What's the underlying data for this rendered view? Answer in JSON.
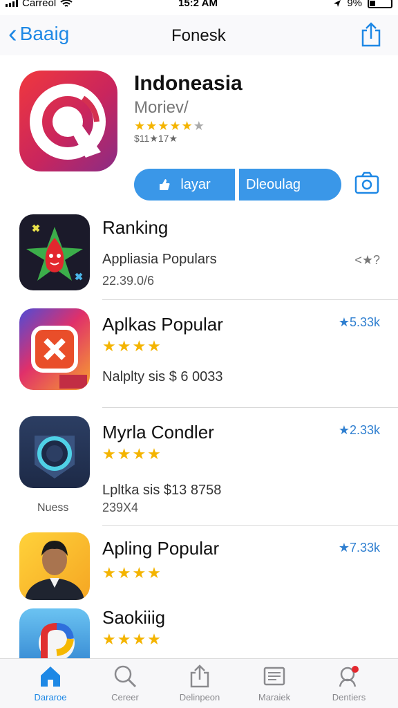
{
  "status": {
    "carrier": "Carreol",
    "time": "15:2 AM",
    "battery": "9%"
  },
  "nav": {
    "back_label": "Baaig",
    "title": "Fonesk"
  },
  "hero": {
    "name": "Indoneasia",
    "subtitle": "Moriev/",
    "stars": 5,
    "meta": "$11★17★",
    "play_label": "layar",
    "download_label": "Dleoulag"
  },
  "list": [
    {
      "title": "Ranking",
      "detail": "Appliasia Populars",
      "meta": "22.39.0/6",
      "rating": "<★?"
    },
    {
      "title": "Aplkas Popular",
      "detail": "Nalplty sis $ 6 0033",
      "rating": "★5.33k",
      "stars": 4
    },
    {
      "title": "Myrla Condler",
      "detail": "Lpltka sis $13 8758",
      "meta": "239X4",
      "rating": "★2.33k",
      "stars": 4,
      "side_label": "Nuess"
    },
    {
      "title": "Apling Popular",
      "rating": "★7.33k",
      "stars": 4
    },
    {
      "title": "Saokiiig",
      "stars": 4
    }
  ],
  "tabs": [
    {
      "label": "Dararoe",
      "icon": "home-icon"
    },
    {
      "label": "Cereer",
      "icon": "search-icon"
    },
    {
      "label": "Delinpeon",
      "icon": "share-icon"
    },
    {
      "label": "Maraiek",
      "icon": "list-icon"
    },
    {
      "label": "Dentiers",
      "icon": "profile-icon"
    }
  ],
  "colors": {
    "accent": "#1e88e5",
    "star": "#f4b400",
    "button": "#3a97e8"
  }
}
